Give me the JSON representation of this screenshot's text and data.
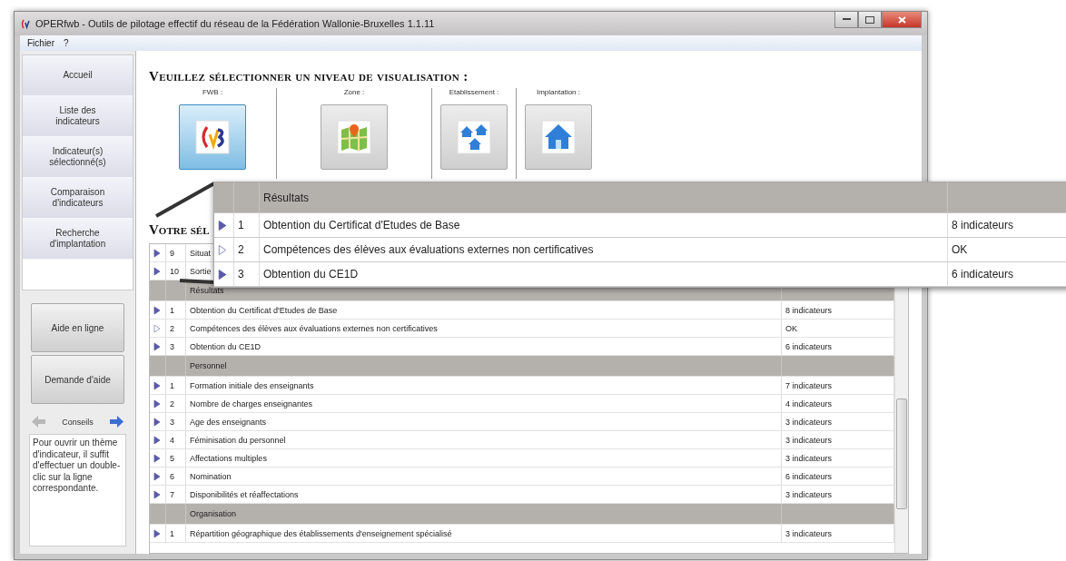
{
  "window": {
    "title": "OPERfwb - Outils de pilotage effectif du réseau de la Fédération Wallonie-Bruxelles 1.1.11"
  },
  "menu": [
    "Fichier",
    "?"
  ],
  "sidebar": {
    "nav": [
      "Accueil",
      "Liste des indicateurs",
      "Indicateur(s) sélectionné(s)",
      "Comparaison d'indicateurs",
      "Recherche d'implantation"
    ],
    "help_buttons": [
      "Aide en ligne",
      "Demande d'aide"
    ],
    "tips": {
      "title": "Conseils",
      "prev_enabled": false,
      "next_enabled": true,
      "text": "Pour ouvrir un thème d'indicateur, il suffit d'effectuer un double-clic sur la ligne correspondante."
    }
  },
  "selector": {
    "title": "Veuillez sélectionner un niveau de visualisation :",
    "levels": [
      {
        "label": "FWB :",
        "kind": "fwb",
        "selected": true
      },
      {
        "label": "Zone :",
        "kind": "zone",
        "selected": false
      },
      {
        "label": "Etablissement :",
        "kind": "etablissement",
        "selected": false
      },
      {
        "label": "Implantation :",
        "kind": "implantation",
        "selected": false
      }
    ]
  },
  "selection": {
    "title": "Votre sél",
    "rows": [
      {
        "kind": "indicator",
        "available": true,
        "number": "9",
        "name": "Situat"
      },
      {
        "kind": "indicator",
        "available": true,
        "number": "10",
        "name": "Sortie"
      },
      {
        "kind": "group",
        "name": "Résultats"
      },
      {
        "kind": "indicator",
        "available": true,
        "number": "1",
        "name": "Obtention du Certificat d'Etudes de Base",
        "count": "8 indicateurs"
      },
      {
        "kind": "indicator",
        "available": false,
        "number": "2",
        "name": "Compétences des élèves aux évaluations externes non certificatives",
        "count": "OK"
      },
      {
        "kind": "indicator",
        "available": true,
        "number": "3",
        "name": "Obtention du CE1D",
        "count": "6 indicateurs"
      },
      {
        "kind": "group",
        "name": "Personnel"
      },
      {
        "kind": "indicator",
        "available": true,
        "number": "1",
        "name": "Formation initiale des enseignants",
        "count": "7 indicateurs"
      },
      {
        "kind": "indicator",
        "available": true,
        "number": "2",
        "name": "Nombre de charges enseignantes",
        "count": "4 indicateurs"
      },
      {
        "kind": "indicator",
        "available": true,
        "number": "3",
        "name": "Age des enseignants",
        "count": "3 indicateurs"
      },
      {
        "kind": "indicator",
        "available": true,
        "number": "4",
        "name": "Féminisation du personnel",
        "count": "3 indicateurs"
      },
      {
        "kind": "indicator",
        "available": true,
        "number": "5",
        "name": "Affectations multiples",
        "count": "3 indicateurs"
      },
      {
        "kind": "indicator",
        "available": true,
        "number": "6",
        "name": "Nomination",
        "count": "6 indicateurs"
      },
      {
        "kind": "indicator",
        "available": true,
        "number": "7",
        "name": "Disponibilités et réaffectations",
        "count": "3 indicateurs"
      },
      {
        "kind": "group",
        "name": "Organisation"
      },
      {
        "kind": "indicator",
        "available": true,
        "number": "1",
        "name": "Répartition géographique des établissements d'enseignement spécialisé",
        "count": "3 indicateurs"
      }
    ]
  },
  "callout": {
    "rows": [
      {
        "kind": "group",
        "name": "Résultats"
      },
      {
        "kind": "indicator",
        "available": true,
        "number": "1",
        "name": "Obtention du Certificat d'Etudes de Base",
        "count": "8 indicateurs"
      },
      {
        "kind": "indicator",
        "available": false,
        "number": "2",
        "name": "Compétences des élèves aux évaluations externes non certificatives",
        "count": "OK"
      },
      {
        "kind": "indicator",
        "available": true,
        "number": "3",
        "name": "Obtention du CE1D",
        "count": "6 indicateurs"
      }
    ]
  }
}
